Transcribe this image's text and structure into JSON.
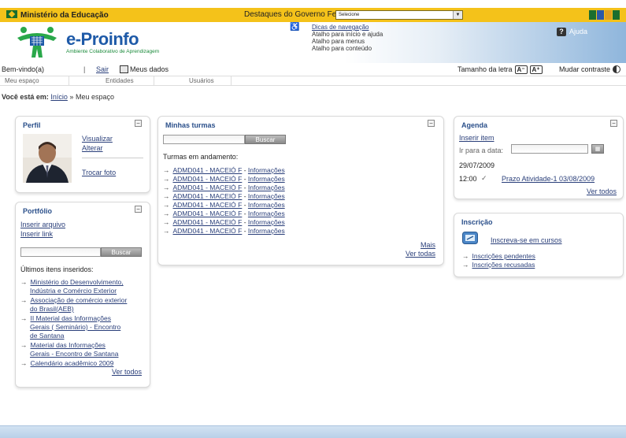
{
  "gov_bar": {
    "ministry": "Ministério da Educação",
    "highlights_label": "Destaques do Governo Federal:",
    "highlights_select": "Selecione",
    "colors": {
      "bar": "#f4c21a",
      "flag": "#1a6e2e"
    }
  },
  "header": {
    "logo_title": "e-Proinfo",
    "logo_subtitle": "Ambiente Colaborativo de Aprendizagem",
    "accessibility": {
      "link": "Dicas de navegação",
      "shortcuts": [
        "Atalho para início e ajuda",
        "Atalho para menus",
        "Atalho para conteúdo"
      ]
    },
    "help_label": "Ajuda"
  },
  "welcome": {
    "greeting": "Bem-vindo(a)",
    "separator": "|",
    "logout": "Sair",
    "my_data": "Meus dados",
    "font_size_label": "Tamanho da letra",
    "font_minus": "A⁻",
    "font_plus": "A⁺",
    "contrast_label": "Mudar contraste"
  },
  "tabs": [
    "Meu espaço",
    "Entidades",
    "Usuários"
  ],
  "breadcrumb": {
    "label": "Você está em:",
    "home": "Início",
    "separator": "»",
    "current": "Meu espaço"
  },
  "profile": {
    "title": "Perfil",
    "view": "Visualizar",
    "edit": "Alterar",
    "change_photo": "Trocar foto"
  },
  "portfolio": {
    "title": "Portfólio",
    "insert_file": "Inserir arquivo",
    "insert_link": "Inserir link",
    "search_button": "Buscar",
    "recent_title": "Últimos itens inseridos:",
    "items": [
      [
        "Ministério do Desenvolvimento,",
        "Indústria e Comércio Exterior"
      ],
      [
        "Associação de comércio exterior",
        "do Brasil(AEB)"
      ],
      [
        "II Material das Informações",
        "Gerais ( Seminário) - Encontro",
        "de Santana"
      ],
      [
        "Material das Informações",
        "Gerais - Encontro de Santana"
      ],
      [
        "Calendário acadêmico 2009"
      ]
    ],
    "see_all": "Ver todos"
  },
  "classes": {
    "title": "Minhas turmas",
    "search_button": "Buscar",
    "in_progress": "Turmas em andamento:",
    "items": [
      {
        "name": "ADMD041 - MACEIÓ F",
        "info": "Informações"
      },
      {
        "name": "ADMD041 - MACEIÓ F",
        "info": "Informações"
      },
      {
        "name": "ADMD041 - MACEIÓ F",
        "info": "Informações"
      },
      {
        "name": "ADMD041 - MACEIÓ F",
        "info": "Informações"
      },
      {
        "name": "ADMD041 - MACEIÓ F",
        "info": "Informações"
      },
      {
        "name": "ADMD041 - MACEIÓ F",
        "info": "Informações"
      },
      {
        "name": "ADMD041 - MACEIÓ F",
        "info": "Informações"
      },
      {
        "name": "ADMD041 - MACEIÓ F",
        "info": "Informações"
      }
    ],
    "more": "Mais",
    "see_all": "Ver todas"
  },
  "agenda": {
    "title": "Agenda",
    "insert_item": "Inserir item",
    "go_to_date": "Ir para a data:",
    "date": "29/07/2009",
    "event_time": "12:00",
    "event_check": "✓",
    "event_title": "Prazo Atividade-1 03/08/2009",
    "see_all": "Ver todos"
  },
  "enrollment": {
    "title": "Inscrição",
    "enroll": "Inscreva-se em cursos",
    "pending": "Inscrições pendentes",
    "refused": "Inscrições recusadas"
  },
  "icons": {
    "toggle": "minus-icon",
    "arrow": "→",
    "calendar": "calendar-icon",
    "accessibility": "accessibility-icon",
    "help": "help-icon",
    "enroll": "enroll-icon"
  }
}
